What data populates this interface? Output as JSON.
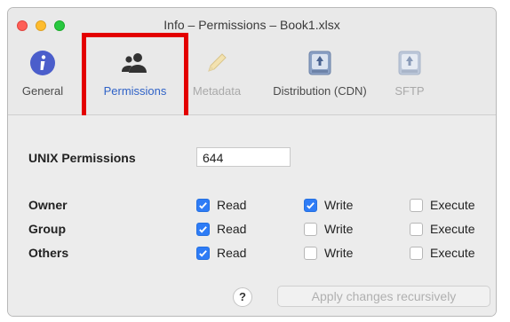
{
  "window": {
    "title": "Info – Permissions – Book1.xlsx"
  },
  "toolbar": {
    "items": [
      {
        "label": "General",
        "icon": "info-icon",
        "state": "normal"
      },
      {
        "label": "Permissions",
        "icon": "users-icon",
        "state": "selected"
      },
      {
        "label": "Metadata",
        "icon": "pencil-icon",
        "state": "disabled"
      },
      {
        "label": "Distribution (CDN)",
        "icon": "drive-icon",
        "state": "normal"
      },
      {
        "label": "SFTP",
        "icon": "drive-icon",
        "state": "disabled"
      }
    ]
  },
  "permissions": {
    "unix_label": "UNIX Permissions",
    "unix_value": "644",
    "columns": [
      "Read",
      "Write",
      "Execute"
    ],
    "rows": [
      {
        "label": "Owner",
        "read": true,
        "write": true,
        "execute": false
      },
      {
        "label": "Group",
        "read": true,
        "write": false,
        "execute": false
      },
      {
        "label": "Others",
        "read": true,
        "write": false,
        "execute": false
      }
    ]
  },
  "help": {
    "label": "?"
  },
  "apply_button": {
    "label": "Apply changes recursively",
    "enabled": false
  },
  "colors": {
    "accent": "#2e7cf6",
    "highlight_box": "#e30000"
  }
}
